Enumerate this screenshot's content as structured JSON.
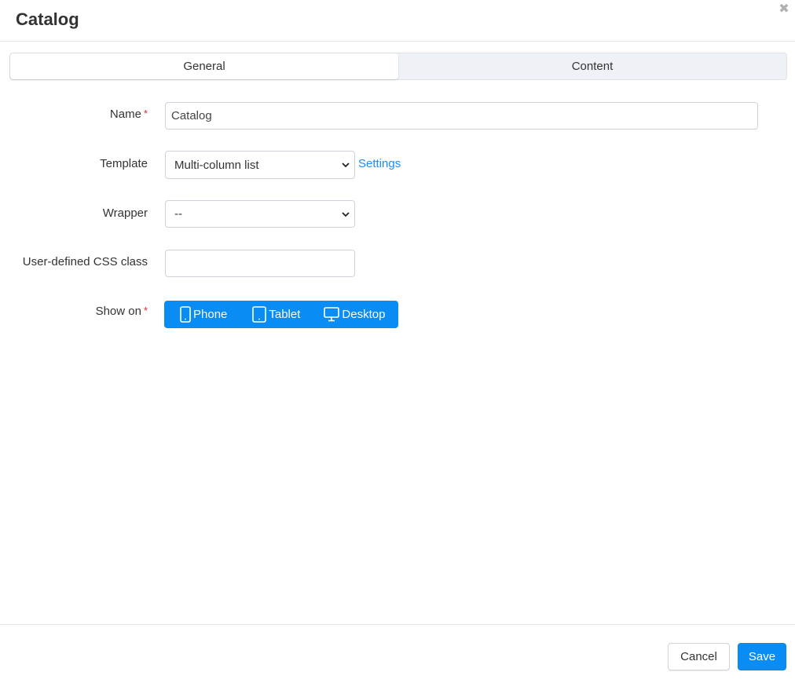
{
  "modal": {
    "title": "Catalog",
    "close_icon": "close-icon"
  },
  "tabs": [
    {
      "label": "General",
      "active": true
    },
    {
      "label": "Content",
      "active": false
    }
  ],
  "form": {
    "name": {
      "label": "Name",
      "required_mark": "*",
      "value": "Catalog"
    },
    "template": {
      "label": "Template",
      "selected": "Multi-column list",
      "settings_link": "Settings"
    },
    "wrapper": {
      "label": "Wrapper",
      "selected": "--"
    },
    "css_class": {
      "label": "User-defined CSS class",
      "value": ""
    },
    "show_on": {
      "label": "Show on",
      "required_mark": "*",
      "options": [
        {
          "label": "Phone",
          "icon": "phone-icon"
        },
        {
          "label": "Tablet",
          "icon": "tablet-icon"
        },
        {
          "label": "Desktop",
          "icon": "desktop-icon"
        }
      ]
    }
  },
  "footer": {
    "cancel_label": "Cancel",
    "save_label": "Save"
  },
  "colors": {
    "primary": "#0a8cf5",
    "link": "#1a8cff",
    "required": "#e02424"
  }
}
